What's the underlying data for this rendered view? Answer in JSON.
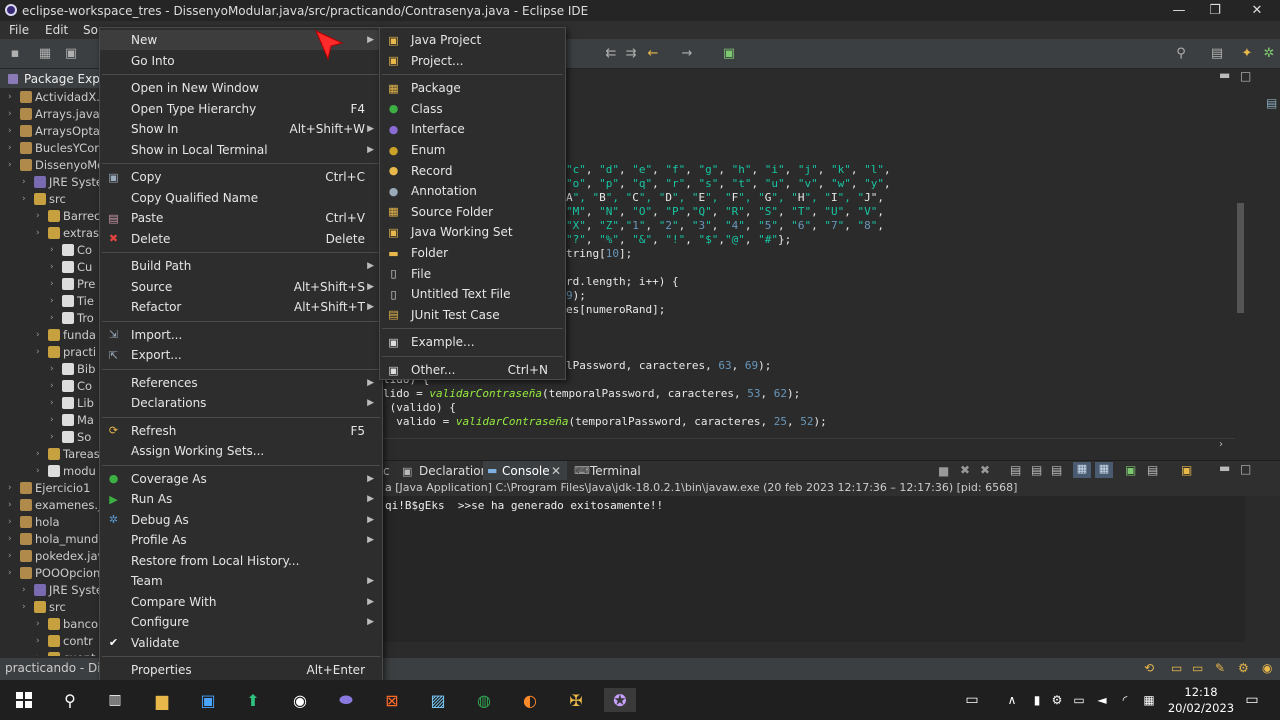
{
  "window": {
    "title": "eclipse-workspace_tres - DissenyoModular.java/src/practicando/Contrasenya.java - Eclipse IDE",
    "minimize": "—",
    "maximize": "❐",
    "close": "✕"
  },
  "menubar": [
    "File",
    "Edit",
    "So"
  ],
  "package_explorer": {
    "tab": "Package Explorer",
    "rows": [
      {
        "label": "ActividadX.j",
        "depth": 0,
        "icon": "#b08a4a"
      },
      {
        "label": "Arrays.java",
        "depth": 0,
        "icon": "#b08a4a"
      },
      {
        "label": "ArraysOptat",
        "depth": 0,
        "icon": "#b08a4a"
      },
      {
        "label": "BuclesYCon",
        "depth": 0,
        "icon": "#b08a4a"
      },
      {
        "label": "DissenyoMo",
        "depth": 0,
        "icon": "#b08a4a"
      },
      {
        "label": "JRE Syste",
        "depth": 1,
        "icon": "#7a6bb0"
      },
      {
        "label": "src",
        "depth": 1,
        "icon": "#c7a13f"
      },
      {
        "label": "Barrec",
        "depth": 2,
        "icon": "#c7a13f"
      },
      {
        "label": "extras",
        "depth": 2,
        "icon": "#c7a13f"
      },
      {
        "label": "Co",
        "depth": 3,
        "icon": "#ddd"
      },
      {
        "label": "Cu",
        "depth": 3,
        "icon": "#ddd"
      },
      {
        "label": "Pre",
        "depth": 3,
        "icon": "#ddd"
      },
      {
        "label": "Tie",
        "depth": 3,
        "icon": "#ddd"
      },
      {
        "label": "Tro",
        "depth": 3,
        "icon": "#ddd"
      },
      {
        "label": "funda",
        "depth": 2,
        "icon": "#c7a13f"
      },
      {
        "label": "practi",
        "depth": 2,
        "icon": "#c7a13f"
      },
      {
        "label": "Bib",
        "depth": 3,
        "icon": "#ddd"
      },
      {
        "label": "Co",
        "depth": 3,
        "icon": "#ddd"
      },
      {
        "label": "Lib",
        "depth": 3,
        "icon": "#ddd"
      },
      {
        "label": "Ma",
        "depth": 3,
        "icon": "#ddd"
      },
      {
        "label": "So",
        "depth": 3,
        "icon": "#ddd"
      },
      {
        "label": "Tareas",
        "depth": 2,
        "icon": "#c7a13f"
      },
      {
        "label": "modu",
        "depth": 2,
        "icon": "#ddd"
      },
      {
        "label": "Ejercicio1",
        "depth": 0,
        "icon": "#b08a4a"
      },
      {
        "label": "examenes.ja",
        "depth": 0,
        "icon": "#b08a4a"
      },
      {
        "label": "hola",
        "depth": 0,
        "icon": "#b08a4a"
      },
      {
        "label": "hola_mundo",
        "depth": 0,
        "icon": "#b08a4a"
      },
      {
        "label": "pokedex.java",
        "depth": 0,
        "icon": "#b08a4a"
      },
      {
        "label": "POOOpcion",
        "depth": 0,
        "icon": "#b08a4a"
      },
      {
        "label": "JRE Syste",
        "depth": 1,
        "icon": "#7a6bb0"
      },
      {
        "label": "src",
        "depth": 1,
        "icon": "#c7a13f"
      },
      {
        "label": "banco",
        "depth": 2,
        "icon": "#c7a13f"
      },
      {
        "label": "contr",
        "depth": 2,
        "icon": "#c7a13f"
      },
      {
        "label": "cuent",
        "depth": 2,
        "icon": "#c7a13f"
      }
    ]
  },
  "editor_lines": [
    "\"c\", \"d\", \"e\", \"f\", \"g\", \"h\", \"i\", \"j\", \"k\", \"l\",",
    "\"o\", \"p\", \"q\", \"r\", \"s\", \"t\", \"u\", \"v\", \"w\", \"y\",",
    "A\", \"B\", \"C\", \"D\", \"E\", \"F\", \"G\", \"H\", \"I\", \"J\",",
    "\"M\", \"N\", \"O\", \"P\",\"Q\", \"R\", \"S\", \"T\", \"U\", \"V\",",
    "\"X\", \"Z\",\"1\", \"2\", \"3\", \"4\", \"5\", \"6\", \"7\", \"8\",",
    "\"?\", \"%\", \"&\", \"!\", \"$\",\"@\", \"#\"};",
    "tring[10];",
    "",
    "rd.length; i++) {",
    "9);",
    "es[numeroRand];",
    "",
    "",
    "lPassword, caracteres, 63, 69);",
    "lido) {",
    "lido = validarContraseña(temporalPassword, caracteres, 53, 62);",
    " (valido) {",
    "  valido = validarContraseña(temporalPassword, caracteres, 25, 52);"
  ],
  "console": {
    "tabs": [
      "Declaration",
      "Console",
      "Terminal"
    ],
    "path": "a [Java Application] C:\\Program Files\\Java\\jdk-18.0.2.1\\bin\\javaw.exe  (20 feb 2023 12:17:36 – 12:17:36) [pid: 6568]",
    "output": "qi!B$gEks  >>se ha generado exitosamente!!"
  },
  "status": "practicando - Disse",
  "context_menu": [
    {
      "label": "New",
      "shortcut": "",
      "submenu": true,
      "icon": ""
    },
    {
      "label": "Go Into",
      "shortcut": "",
      "submenu": false,
      "icon": ""
    },
    {
      "sep": true
    },
    {
      "label": "Open in New Window",
      "shortcut": "",
      "submenu": false,
      "icon": ""
    },
    {
      "label": "Open Type Hierarchy",
      "shortcut": "F4",
      "submenu": false,
      "icon": ""
    },
    {
      "label": "Show In",
      "shortcut": "Alt+Shift+W",
      "submenu": true,
      "icon": ""
    },
    {
      "label": "Show in Local Terminal",
      "shortcut": "",
      "submenu": true,
      "icon": ""
    },
    {
      "sep": true
    },
    {
      "label": "Copy",
      "shortcut": "Ctrl+C",
      "submenu": false,
      "icon": "copy"
    },
    {
      "label": "Copy Qualified Name",
      "shortcut": "",
      "submenu": false,
      "icon": ""
    },
    {
      "label": "Paste",
      "shortcut": "Ctrl+V",
      "submenu": false,
      "icon": "paste"
    },
    {
      "label": "Delete",
      "shortcut": "Delete",
      "submenu": false,
      "icon": "delete"
    },
    {
      "sep": true
    },
    {
      "label": "Build Path",
      "shortcut": "",
      "submenu": true,
      "icon": ""
    },
    {
      "label": "Source",
      "shortcut": "Alt+Shift+S",
      "submenu": true,
      "icon": ""
    },
    {
      "label": "Refactor",
      "shortcut": "Alt+Shift+T",
      "submenu": true,
      "icon": ""
    },
    {
      "sep": true
    },
    {
      "label": "Import...",
      "shortcut": "",
      "submenu": false,
      "icon": "import"
    },
    {
      "label": "Export...",
      "shortcut": "",
      "submenu": false,
      "icon": "export"
    },
    {
      "sep": true
    },
    {
      "label": "References",
      "shortcut": "",
      "submenu": true,
      "icon": ""
    },
    {
      "label": "Declarations",
      "shortcut": "",
      "submenu": true,
      "icon": ""
    },
    {
      "sep": true
    },
    {
      "label": "Refresh",
      "shortcut": "F5",
      "submenu": false,
      "icon": "refresh"
    },
    {
      "label": "Assign Working Sets...",
      "shortcut": "",
      "submenu": false,
      "icon": ""
    },
    {
      "sep": true
    },
    {
      "label": "Coverage As",
      "shortcut": "",
      "submenu": true,
      "icon": "coverage"
    },
    {
      "label": "Run As",
      "shortcut": "",
      "submenu": true,
      "icon": "run"
    },
    {
      "label": "Debug As",
      "shortcut": "",
      "submenu": true,
      "icon": "debug"
    },
    {
      "label": "Profile As",
      "shortcut": "",
      "submenu": true,
      "icon": ""
    },
    {
      "label": "Restore from Local History...",
      "shortcut": "",
      "submenu": false,
      "icon": ""
    },
    {
      "label": "Team",
      "shortcut": "",
      "submenu": true,
      "icon": ""
    },
    {
      "label": "Compare With",
      "shortcut": "",
      "submenu": true,
      "icon": ""
    },
    {
      "label": "Configure",
      "shortcut": "",
      "submenu": true,
      "icon": ""
    },
    {
      "label": "Validate",
      "shortcut": "",
      "submenu": false,
      "icon": "check"
    },
    {
      "sep": true
    },
    {
      "label": "Properties",
      "shortcut": "Alt+Enter",
      "submenu": false,
      "icon": ""
    }
  ],
  "new_submenu": [
    {
      "label": "Java Project",
      "shortcut": "",
      "icon": "java-project"
    },
    {
      "label": "Project...",
      "shortcut": "",
      "icon": "project"
    },
    {
      "sep": true
    },
    {
      "label": "Package",
      "shortcut": "",
      "icon": "package"
    },
    {
      "label": "Class",
      "shortcut": "",
      "icon": "class"
    },
    {
      "label": "Interface",
      "shortcut": "",
      "icon": "interface"
    },
    {
      "label": "Enum",
      "shortcut": "",
      "icon": "enum"
    },
    {
      "label": "Record",
      "shortcut": "",
      "icon": "record"
    },
    {
      "label": "Annotation",
      "shortcut": "",
      "icon": "annotation"
    },
    {
      "label": "Source Folder",
      "shortcut": "",
      "icon": "source-folder"
    },
    {
      "label": "Java Working Set",
      "shortcut": "",
      "icon": "working-set"
    },
    {
      "label": "Folder",
      "shortcut": "",
      "icon": "folder"
    },
    {
      "label": "File",
      "shortcut": "",
      "icon": "file"
    },
    {
      "label": "Untitled Text File",
      "shortcut": "",
      "icon": "text-file"
    },
    {
      "label": "JUnit Test Case",
      "shortcut": "",
      "icon": "junit"
    },
    {
      "sep": true
    },
    {
      "label": "Example...",
      "shortcut": "",
      "icon": "example"
    },
    {
      "sep": true
    },
    {
      "label": "Other...",
      "shortcut": "Ctrl+N",
      "icon": "other"
    }
  ],
  "clock": {
    "time": "12:18",
    "date": "20/02/2023"
  }
}
